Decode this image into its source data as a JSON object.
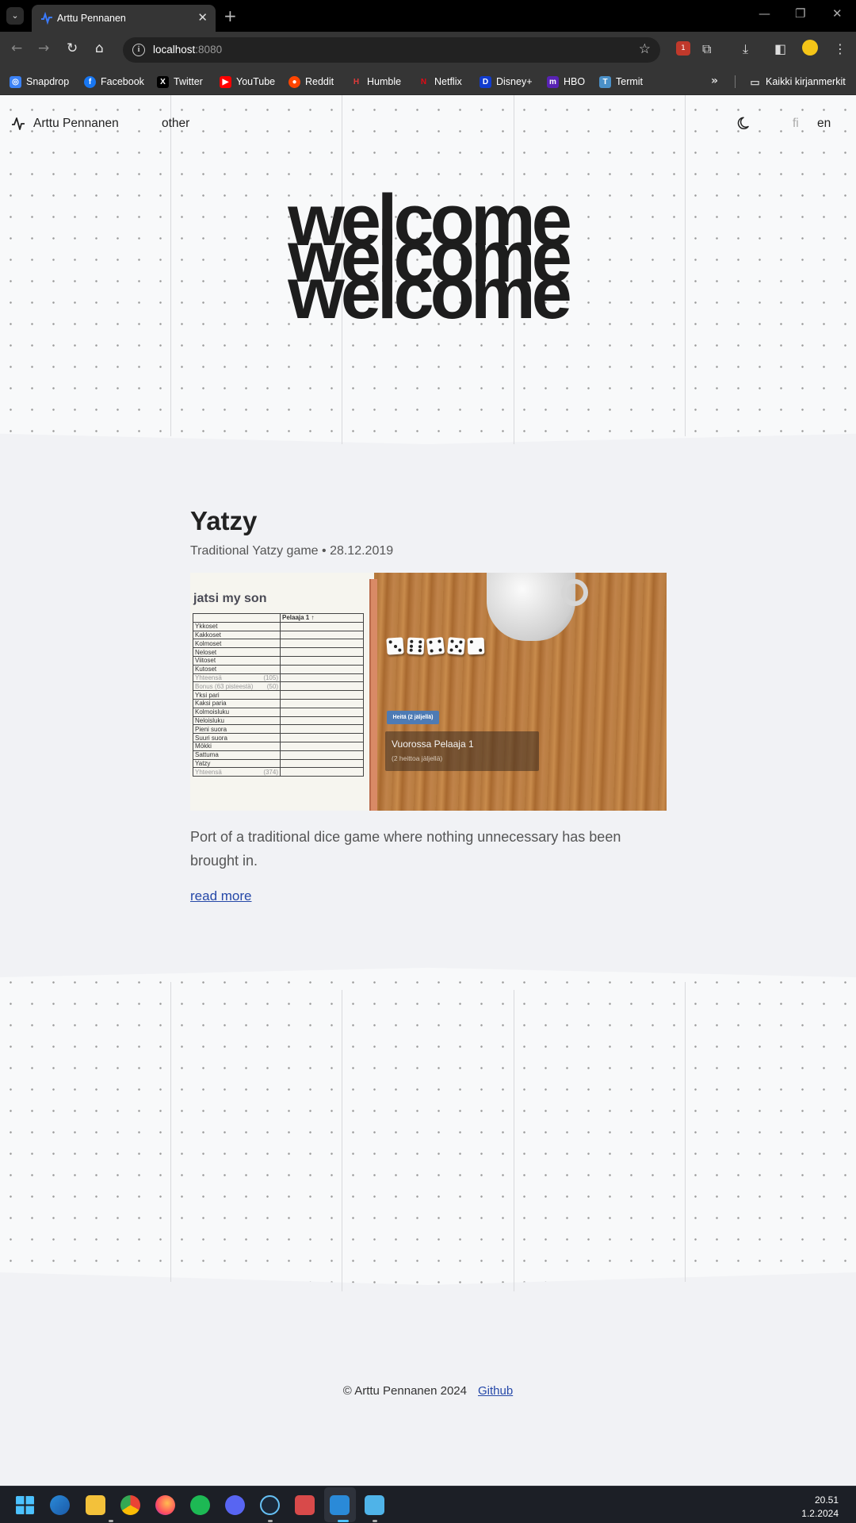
{
  "browser": {
    "tab_title": "Arttu Pennanen",
    "url_host": "localhost",
    "url_port": ":8080",
    "bookmarks": [
      {
        "label": "Snapdrop",
        "icon": "snapdrop-icon",
        "color": "#3b82f6"
      },
      {
        "label": "Facebook",
        "icon": "facebook-icon",
        "color": "#1877f2"
      },
      {
        "label": "Twitter",
        "icon": "x-icon",
        "color": "#000000"
      },
      {
        "label": "YouTube",
        "icon": "youtube-icon",
        "color": "#ff0000"
      },
      {
        "label": "Reddit",
        "icon": "reddit-icon",
        "color": "#ff4500"
      },
      {
        "label": "Humble",
        "icon": "humble-icon",
        "color": "#cc2929"
      },
      {
        "label": "Netflix",
        "icon": "netflix-icon",
        "color": "#e50914"
      },
      {
        "label": "Disney+",
        "icon": "disney-icon",
        "color": "#113ccf"
      },
      {
        "label": "HBO",
        "icon": "hbo-icon",
        "color": "#5822b4"
      },
      {
        "label": "Termit",
        "icon": "termit-icon",
        "color": "#4a90c8"
      }
    ],
    "all_bookmarks_label": "Kaikki kirjanmerkit"
  },
  "nav": {
    "brand": "Arttu Pennanen",
    "link_other": "other",
    "lang_fi": "fi",
    "lang_en": "en"
  },
  "hero": {
    "lines": [
      "welcome",
      "welcome",
      "welcome"
    ]
  },
  "post": {
    "title": "Yatzy",
    "subtitle": "Traditional Yatzy game",
    "date": "28.12.2019",
    "description": "Port of a traditional dice game where nothing unnecessary has been brought in.",
    "read_more": "read more",
    "screenshot": {
      "sheet_title": "jatsi my son",
      "player_header": "Pelaaja 1 ↑",
      "rows": [
        {
          "label": "Ykkoset",
          "value": ""
        },
        {
          "label": "Kakkoset",
          "value": ""
        },
        {
          "label": "Kolmoset",
          "value": ""
        },
        {
          "label": "Neloset",
          "value": ""
        },
        {
          "label": "Viitoset",
          "value": ""
        },
        {
          "label": "Kutoset",
          "value": ""
        },
        {
          "label": "Yhteensä",
          "value": "(105)"
        },
        {
          "label": "Bonus (63 pisteestä)",
          "value": "(50)"
        },
        {
          "label": "Yksi pari",
          "value": ""
        },
        {
          "label": "Kaksi paria",
          "value": ""
        },
        {
          "label": "Kolmoisluku",
          "value": ""
        },
        {
          "label": "Neloisluku",
          "value": ""
        },
        {
          "label": "Pieni suora",
          "value": ""
        },
        {
          "label": "Suuri suora",
          "value": ""
        },
        {
          "label": "Mökki",
          "value": ""
        },
        {
          "label": "Sattuma",
          "value": ""
        },
        {
          "label": "Yatzy",
          "value": ""
        },
        {
          "label": "Yhteensä",
          "value": "(374)"
        }
      ],
      "dice": [
        3,
        6,
        4,
        5,
        2
      ],
      "throw_button": "Heitä (2 jäljellä)",
      "turn_title": "Vuorossa Pelaaja 1",
      "turn_sub": "(2 heittoa jäljellä)"
    }
  },
  "footer": {
    "copyright": "© Arttu Pennanen 2024",
    "github": "Github"
  },
  "taskbar": {
    "time": "20.51",
    "date": "1.2.2024"
  }
}
